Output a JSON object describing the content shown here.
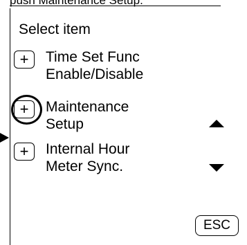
{
  "caption": "push Maintenance Setup.",
  "screen": {
    "title": "Select item",
    "items": [
      {
        "plus": "+",
        "line1": "Time Set Func",
        "line2": "Enable/Disable"
      },
      {
        "plus": "+",
        "line1": "Maintenance",
        "line2": "Setup",
        "selected": true
      },
      {
        "plus": "+",
        "line1": "Internal Hour",
        "line2": "Meter Sync."
      }
    ],
    "esc_label": "ESC"
  },
  "icons": {
    "pointer": "pointer-arrow-icon",
    "scroll_up": "triangle-up-icon",
    "scroll_down": "triangle-down-icon",
    "focus": "focus-circle-icon"
  }
}
